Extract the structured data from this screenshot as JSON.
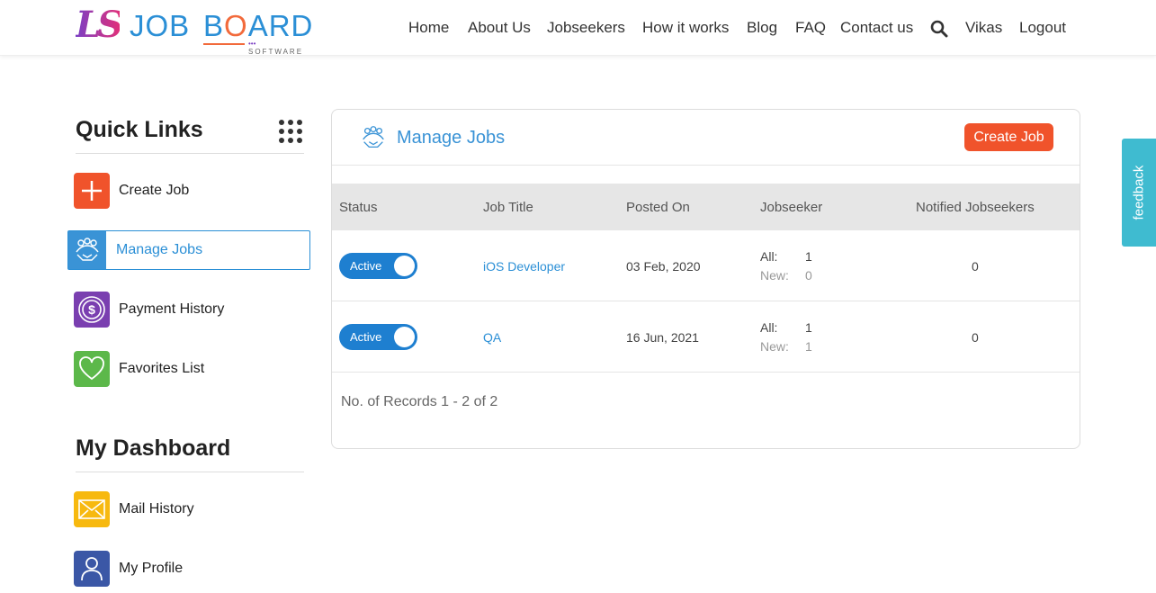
{
  "brand": {
    "ls": "LS",
    "job": "JOB",
    "board_b": "B",
    "board_o": "O",
    "board_rest": "ARD",
    "software": "SOFTWARE",
    "dots": "•••"
  },
  "nav": {
    "home": "Home",
    "about": "About Us",
    "jobseekers": "Jobseekers",
    "how": "How it works",
    "blog": "Blog",
    "faq": "FAQ",
    "contact": "Contact us",
    "user": "Vikas",
    "logout": "Logout"
  },
  "quick_links": {
    "title": "Quick Links",
    "items": [
      {
        "label": "Create Job",
        "icon": "plus-icon",
        "color": "#f0532b"
      },
      {
        "label": "Manage Jobs",
        "icon": "team-handshake-icon",
        "color": "#3a93d6"
      },
      {
        "label": "Payment History",
        "icon": "dollar-coin-icon",
        "color": "#7a3fb0"
      },
      {
        "label": "Favorites List",
        "icon": "heart-icon",
        "color": "#5cb84a"
      }
    ]
  },
  "dashboard": {
    "title": "My Dashboard",
    "items": [
      {
        "label": "Mail History",
        "icon": "envelope-icon",
        "color": "#f7b90f"
      },
      {
        "label": "My Profile",
        "icon": "user-icon",
        "color": "#3b57a6"
      }
    ]
  },
  "panel": {
    "title": "Manage Jobs",
    "create_button": "Create Job",
    "columns": [
      "Status",
      "Job Title",
      "Posted On",
      "Jobseeker",
      "Notified Jobseekers"
    ],
    "rows": [
      {
        "status": "Active",
        "title": "iOS Developer",
        "posted": "03 Feb, 2020",
        "all_label": "All:",
        "all": "1",
        "new_label": "New:",
        "new": "0",
        "notified": "0"
      },
      {
        "status": "Active",
        "title": "QA",
        "posted": "16 Jun, 2021",
        "all_label": "All:",
        "all": "1",
        "new_label": "New:",
        "new": "1",
        "notified": "0"
      }
    ],
    "records": "No. of Records 1 - 2 of 2"
  },
  "feedback": "feedback"
}
